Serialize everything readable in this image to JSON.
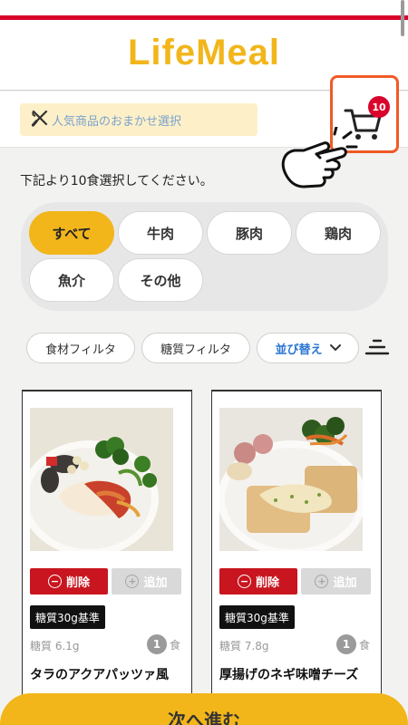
{
  "header": {
    "logo": "LifeMeal"
  },
  "toolbar": {
    "recommend_label": "人気商品のおまかせ選択",
    "cart_count": "10"
  },
  "instruction": "下記より10食選択してください。",
  "categories": [
    {
      "label": "すべて",
      "active": true
    },
    {
      "label": "牛肉",
      "active": false
    },
    {
      "label": "豚肉",
      "active": false
    },
    {
      "label": "鶏肉",
      "active": false
    },
    {
      "label": "魚介",
      "active": false
    },
    {
      "label": "その他",
      "active": false
    }
  ],
  "filters": {
    "ingredient": "食材フィルタ",
    "carb": "糖質フィルタ",
    "sort": "並び替え"
  },
  "products": [
    {
      "delete_label": "削除",
      "add_label": "追加",
      "tag": "糖質30g基準",
      "carb": "糖質 6.1g",
      "qty": "1",
      "qty_unit": "食",
      "name": "タラのアクアパッツァ風"
    },
    {
      "delete_label": "削除",
      "add_label": "追加",
      "tag": "糖質30g基準",
      "carb": "糖質 7.8g",
      "qty": "1",
      "qty_unit": "食",
      "name": "厚揚げのネギ味噌チーズ"
    }
  ],
  "footer": {
    "next_label": "次へ進む"
  },
  "colors": {
    "brand": "#f2b61b",
    "accent_red": "#d9042b",
    "cart_border": "#f05a27",
    "sort_blue": "#2a76d2"
  },
  "icons": [
    "cutlery-icon",
    "cart-icon",
    "hand-pointer-icon",
    "chevron-down-icon",
    "sort-lines-icon",
    "minus-circle-icon",
    "plus-circle-icon"
  ]
}
